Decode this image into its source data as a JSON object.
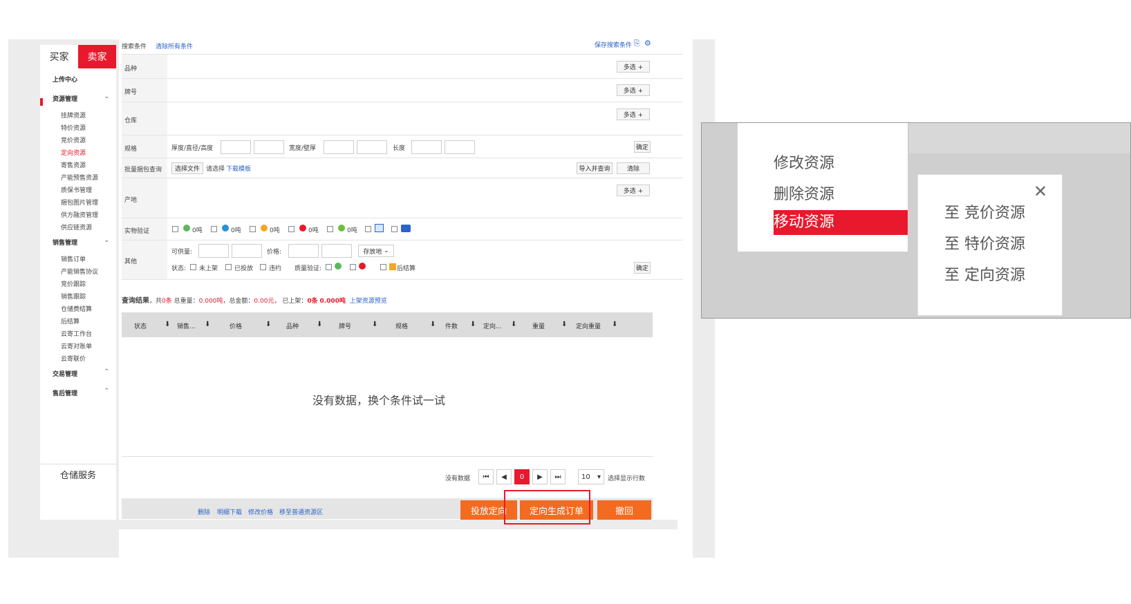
{
  "sidebar": {
    "role_tabs": [
      "买家",
      "卖家"
    ],
    "upload_center": "上传中心",
    "groups": [
      {
        "label": "资源管理",
        "items": [
          "挂牌资源",
          "特价资源",
          "竞价资源",
          "定向资源",
          "寄售资源",
          "产能预售资源",
          "质保书管理",
          "捆包图片管理",
          "供方融资管理",
          "供应链资源"
        ]
      },
      {
        "label": "销售管理",
        "items": [
          "销售订单",
          "产能销售协议",
          "竞价跟踪",
          "销售跟踪",
          "仓储费结算",
          "后结算",
          "云寄工作台",
          "云寄对账单",
          "云寄联价"
        ]
      },
      {
        "label": "交易管理",
        "items": []
      },
      {
        "label": "售后管理",
        "items": []
      }
    ],
    "active_item": "定向资源",
    "warehouse": "仓储服务"
  },
  "search": {
    "title": "搜索条件",
    "clear_all": "清除所有条件",
    "save": "保存搜索条件",
    "multi_select": "多选 +",
    "confirm": "确定",
    "rows": {
      "variety": "品种",
      "brand": "牌号",
      "warehouse": "仓库",
      "spec": "规格",
      "batch": "批量捆包查询",
      "origin": "产地",
      "verify": "实物验证",
      "other": "其他"
    },
    "spec_labels": {
      "thickness": "厚度/直径/高度",
      "width": "宽度/壁厚",
      "length": "长度"
    },
    "batch": {
      "choose_file": "选择文件",
      "hint": "请选择",
      "download": "下载模板",
      "import": "导入并查询",
      "clear": "清除"
    },
    "verify_counts": [
      "0吨",
      "0吨",
      "0吨",
      "0吨",
      "0吨"
    ],
    "other": {
      "available": "可供量:",
      "price": "价格:",
      "location": "存放地",
      "status_label": "状态:",
      "statuses": [
        "未上架",
        "已投放",
        "违约"
      ],
      "quality_label": "质量验证:",
      "post_settle": "后结算"
    }
  },
  "result": {
    "label": "查询结果",
    "summary_pre": "，共",
    "count": "0条",
    "weight_label": "总重量：",
    "weight": "0.000吨",
    "amount_label": "，总金额：",
    "amount": "0.00元",
    "listed_label": "， 已上架：",
    "listed_count": "0条",
    "listed_weight": "0.000吨",
    "preview": "上架资源预览"
  },
  "table": {
    "columns": [
      "状态",
      "销售...",
      "价格",
      "品种",
      "牌号",
      "规格",
      "件数",
      "定向...",
      "重量",
      "定向重量"
    ],
    "empty": "没有数据，换个条件试一试"
  },
  "pager": {
    "no_data": "没有数据",
    "current": "0",
    "page_size": "10",
    "rows_label": "选择显示行数"
  },
  "bottom_links": [
    "删除",
    "明细下载",
    "修改价格",
    "移至普通资源区"
  ],
  "actions": {
    "release": "投放定向",
    "generate": "定向生成订单",
    "revoke": "撤回"
  },
  "zoom": {
    "menu": [
      "修改资源",
      "删除资源",
      "移动资源"
    ],
    "popup": [
      "至 竞价资源",
      "至 特价资源",
      "至 定向资源"
    ],
    "close": "✕"
  },
  "colors": {
    "accent": "#e8192c",
    "orange": "#f26b20",
    "link": "#2a62c9"
  }
}
